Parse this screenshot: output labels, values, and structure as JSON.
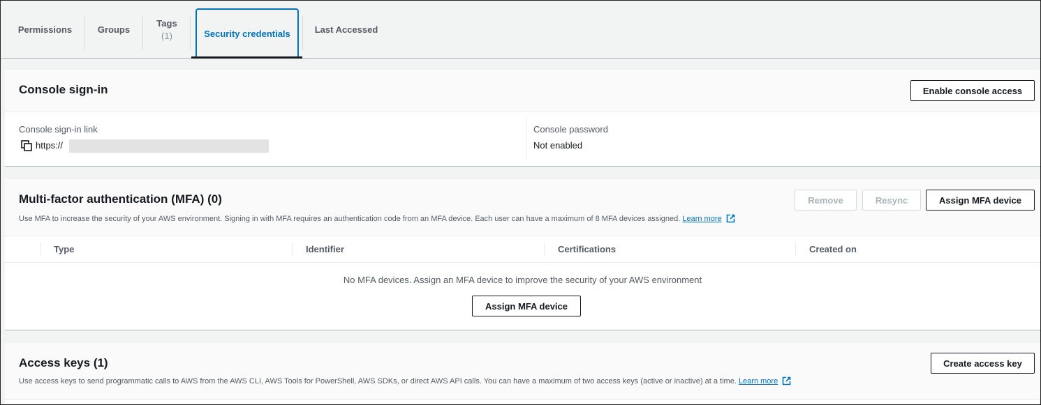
{
  "tabs": [
    {
      "label": "Permissions",
      "count": ""
    },
    {
      "label": "Groups",
      "count": ""
    },
    {
      "label": "Tags",
      "count": "(1)"
    },
    {
      "label": "Security credentials",
      "count": ""
    },
    {
      "label": "Last Accessed",
      "count": ""
    }
  ],
  "active_tab": "Security credentials",
  "console_signin": {
    "title": "Console sign-in",
    "enable_button": "Enable console access",
    "link_label": "Console sign-in link",
    "link_value": "https://",
    "password_label": "Console password",
    "password_value": "Not enabled"
  },
  "mfa": {
    "title": "Multi-factor authentication (MFA) (0)",
    "remove_button": "Remove",
    "resync_button": "Resync",
    "assign_button": "Assign MFA device",
    "description": "Use MFA to increase the security of your AWS environment. Signing in with MFA requires an authentication code from an MFA device. Each user can have a maximum of 8 MFA devices assigned.",
    "learn_more": "Learn more",
    "columns": [
      "Type",
      "Identifier",
      "Certifications",
      "Created on"
    ],
    "empty_message": "No MFA devices. Assign an MFA device to improve the security of your AWS environment",
    "empty_assign_button": "Assign MFA device"
  },
  "access_keys": {
    "title": "Access keys (1)",
    "create_button": "Create access key",
    "description": "Use access keys to send programmatic calls to AWS from the AWS CLI, AWS Tools for PowerShell, AWS SDKs, or direct AWS API calls. You can have a maximum of two access keys (active or inactive) at a time.",
    "learn_more": "Learn more"
  },
  "colors": {
    "accent": "#0073bb",
    "text": "#16191f",
    "muted": "#545b64",
    "background": "#f2f3f3"
  }
}
